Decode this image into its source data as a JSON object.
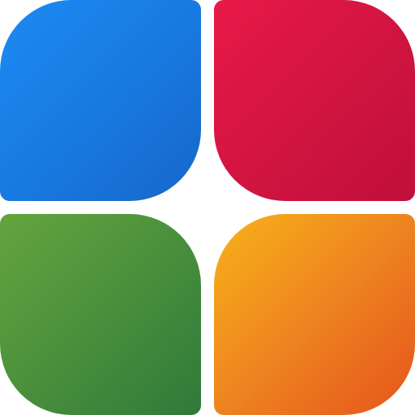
{
  "logo": {
    "icon": "four-petal-tiles-logo",
    "tiles": [
      {
        "position": "top-left",
        "colors": [
          "#1b8bf3",
          "#1866c8"
        ]
      },
      {
        "position": "top-right",
        "colors": [
          "#e81947",
          "#c10f3b"
        ]
      },
      {
        "position": "bottom-left",
        "colors": [
          "#64a53e",
          "#2f7a3b"
        ]
      },
      {
        "position": "bottom-right",
        "colors": [
          "#f7b21a",
          "#e5541c"
        ]
      }
    ]
  }
}
